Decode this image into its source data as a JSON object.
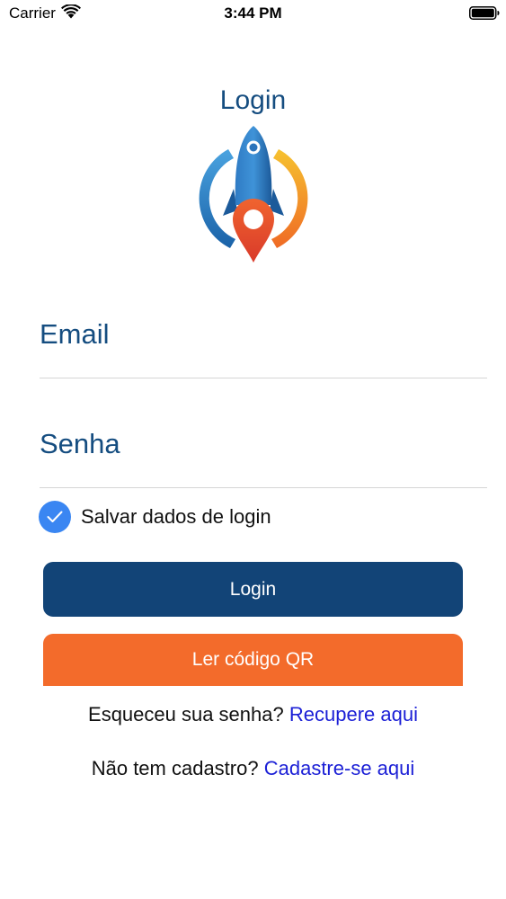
{
  "status_bar": {
    "carrier": "Carrier",
    "time": "3:44 PM",
    "wifi_icon": "wifi-icon",
    "battery_icon": "battery-icon"
  },
  "header": {
    "title": "Login",
    "logo_icon": "rocket-location-logo"
  },
  "form": {
    "email_placeholder": "Email",
    "email_value": "",
    "password_placeholder": "Senha",
    "password_value": "",
    "save_login_label": "Salvar dados de login",
    "save_login_checked": true,
    "login_button": "Login",
    "qr_button": "Ler código QR"
  },
  "links": {
    "forgot_text": "Esqueceu sua senha?",
    "forgot_link": "Recupere aqui",
    "register_text": "Não tem cadastro?",
    "register_link": "Cadastre-se aqui"
  },
  "colors": {
    "primary": "#124477",
    "accent_orange": "#f36b2b",
    "checkbox_blue": "#3a86f2",
    "link_blue": "#1b1fd6",
    "title_blue": "#154d80"
  }
}
